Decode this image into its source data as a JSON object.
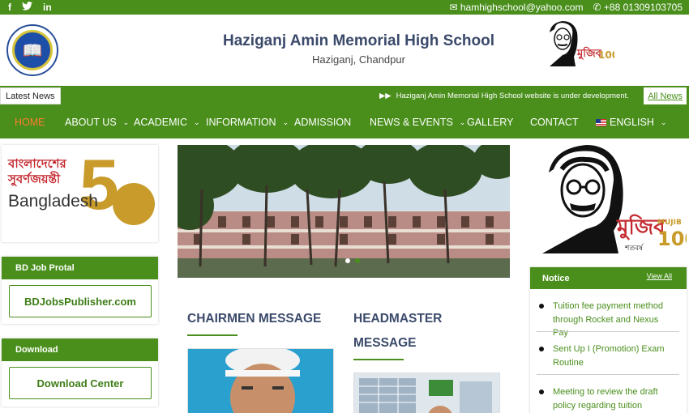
{
  "topbar": {
    "social": [
      {
        "icon": "facebook-icon",
        "glyph": "f"
      },
      {
        "icon": "twitter-icon",
        "glyph": "🐦"
      },
      {
        "icon": "linkedin-icon",
        "glyph": "in"
      }
    ],
    "email": "hamhighschool@yahoo.com",
    "phone": "+88 01309103705"
  },
  "header": {
    "school_name": "Haziganj Amin Memorial High School",
    "location": "Haziganj, Chandpur",
    "mujib_word": "মুজিব",
    "mujib_en": "MUJIB",
    "mujib_num": "100",
    "mujib_sub": "শতবর্ষ"
  },
  "ticker": {
    "label": "Latest News",
    "message": "Haziganj Amin Memorial High School website is under development.",
    "all_news": "All News"
  },
  "nav": {
    "home": "HOME",
    "about": "ABOUT US",
    "academic": "ACADEMIC",
    "information": "INFORMATION",
    "admission": "ADMISSION",
    "news": "NEWS & EVENTS",
    "gallery": "GALLERY",
    "contact": "CONTACT",
    "language": "ENGLISH"
  },
  "left": {
    "bd50_bn_line1": "বাংলাদেশের",
    "bd50_bn_line2": "সুবর্ণজয়ন্তী",
    "bd50_en": "Bangladesh",
    "job_portal_title": "BD Job Protal",
    "job_portal_button": "BDJobsPublisher.com",
    "download_title": "Download",
    "download_button": "Download Center"
  },
  "middle": {
    "chairmen_title": "CHAIRMEN MESSAGE",
    "headmaster_title_1": "HEADMASTER",
    "headmaster_title_2": "MESSAGE"
  },
  "notice": {
    "title": "Notice",
    "view_all": "View All",
    "items": [
      "Tuition fee payment method through Rocket and Nexus Pay",
      "Sent Up I (Promotion) Exam Routine",
      "Meeting to review the draft policy regarding tuition"
    ]
  },
  "colors": {
    "brand_green": "#4a8f1c",
    "active_nav": "#ff7a30",
    "title_navy": "#3b4a6b"
  }
}
